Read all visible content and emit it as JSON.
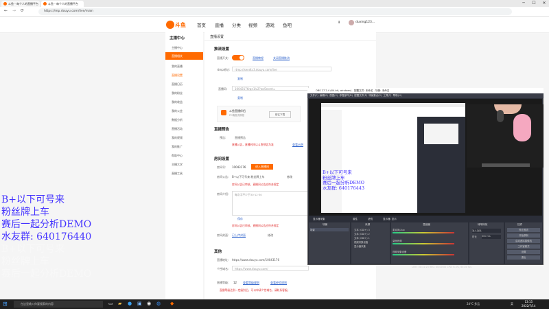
{
  "browser": {
    "tabs": [
      "斗鱼 - 每个人的直播平台",
      "斗鱼 - 每个人的直播平台"
    ],
    "url": "https://mp.douyu.com/live/main",
    "user": "duxing123..."
  },
  "site": {
    "nav": [
      "首页",
      "直播",
      "分类",
      "视频",
      "游戏",
      "鱼吧"
    ],
    "page_title": "直播设置",
    "sidebar": {
      "header": "主播中心",
      "items": [
        "主播中心",
        "直播相关",
        "我的直播",
        "直播设置",
        "直播日历",
        "我的粉丝",
        "我的收益",
        "我的公会",
        "数据分析",
        "直播活动",
        "我的视频",
        "我的推广",
        "帮助中心",
        "主播大学",
        "直播工具"
      ]
    },
    "stream": {
      "section": "推流设置",
      "rtmp_label": "rtmp地址:",
      "rtmp_value": "rtmp://sendtc3.douyu.com/live",
      "key_label": "直播码:",
      "key_value": "10043176rqn1lv2?wsSecret=",
      "copy": "复制",
      "switch_label": "直播开关:",
      "links": [
        "直播教程",
        "关闭直播推流"
      ],
      "tool_name": "斗鱼直播伴侣",
      "tool_sub": "PC端推流教程",
      "download": "前往下载"
    },
    "preview": {
      "section": "直播预告",
      "label": "预告:",
      "value": "直播预告",
      "warn": "直播公告，直播时间以斗鱼预告为准",
      "link": "查看示例"
    },
    "room": {
      "section": "房间设置",
      "id_label": "房间号:",
      "id_value": "10043176",
      "id_btn": "进入直播间",
      "notice_label": "房间公告:",
      "notice_value": "B+以下可号来 粉丝牌上车",
      "notice_btn": "修改",
      "warn": "房间公告已审核，直播间公告应符合规定",
      "intro_label": "房间介绍:",
      "intro_value": "每次字不少于30·12·30",
      "save": "保存",
      "cover_label": "房间封面:",
      "cover_value": "已上传封面",
      "cover_btn": "修改"
    },
    "other": {
      "section": "其他",
      "live_label": "直播地址:",
      "live_value": "https://www.douyu.com/10043176",
      "domain_label": "个性域名:",
      "domain_value": "https://www.douyu.com/",
      "level_label": "直播等级:",
      "level_value": "12",
      "links": [
        "查看等级规则",
        "查看经验规则"
      ],
      "note": "直播等级达到一定级别后，可以申请个性域名，请联系客服。"
    }
  },
  "obs": {
    "title": "OBS 27.2.4 (64-bit, windows) - 配置文件: 未命名 - 场景: 未命名",
    "menu": [
      "文件(F)",
      "编辑(E)",
      "视图(V)",
      "停靠部件(D)",
      "配置文件(P)",
      "场景集合(S)",
      "工具(T)",
      "帮助(H)"
    ],
    "overlay_lines": [
      "B+以下可号来",
      "粉丝牌上车",
      "赛后一起分析DEMO",
      "水友群: 640176443"
    ],
    "source_toolbar": [
      "显示器采集",
      "属性",
      "滤镜",
      "显示器: 显示"
    ],
    "docks": {
      "scenes": {
        "title": "场景",
        "items": [
          "场景"
        ]
      },
      "sources": {
        "title": "来源",
        "items": [
          "文本 (GDI+) 3",
          "文本 (GDI+) 2",
          "文本 (GDI+) 1",
          "视频采集设备",
          "显示器采集"
        ]
      },
      "mixer": {
        "title": "混音器",
        "items": [
          "麦克风/Aux",
          "桌面音频",
          "视频采集设备"
        ]
      },
      "transitions": {
        "title": "转场特效",
        "type": "淡入淡出",
        "duration_label": "时长",
        "duration": "300 ms"
      },
      "controls": {
        "title": "控件",
        "buttons": [
          "停止推流",
          "开始录制",
          "启动虚拟摄像机",
          "工作室模式",
          "设置",
          "退出"
        ]
      }
    },
    "status": "LIVE: 00:11:23  REC: 00:00:00  CPU: 6.3%, 60.00 fps"
  },
  "overlay": {
    "lines": [
      "B+以下可号来",
      "粉丝牌上车",
      "赛后一起分析DEMO",
      "水友群: 640176440"
    ],
    "faded_lines": [
      "B+以下可号来",
      "粉丝牌上车",
      "赛后一起分析DEMO"
    ]
  },
  "taskbar": {
    "search_placeholder": "在这里输入你要搜索的内容",
    "weather": "24°C 多云",
    "time": "13:15",
    "date": "2022/7/14",
    "lang": "英"
  }
}
